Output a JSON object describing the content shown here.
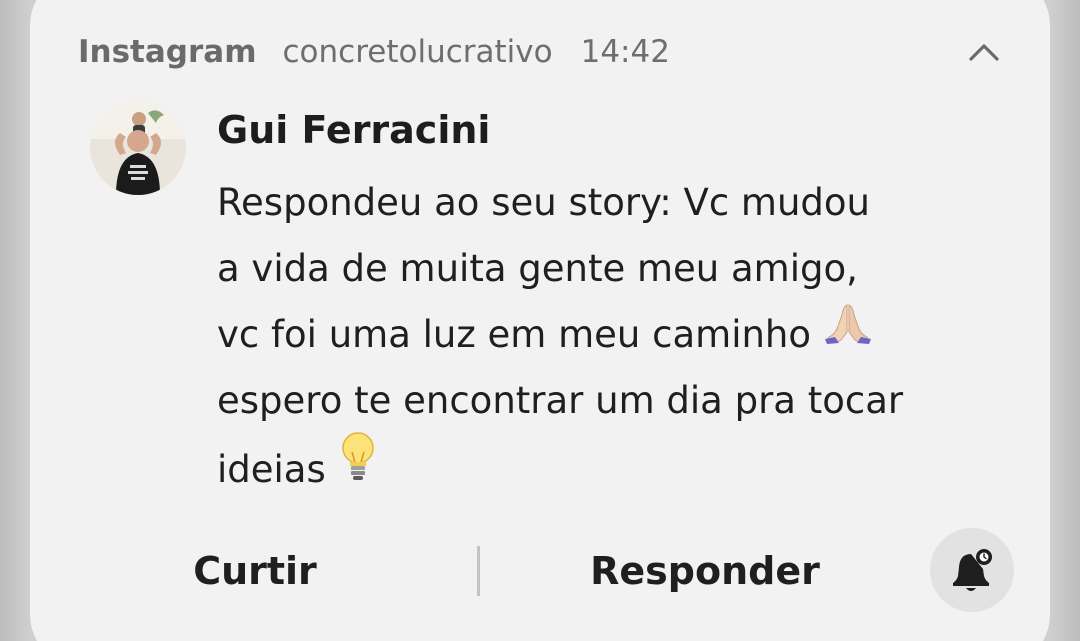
{
  "notification": {
    "app_name": "Instagram",
    "account": "concretolucrativo",
    "time": "14:42",
    "collapse_icon": "chevron-up-icon",
    "sender": "Gui Ferracini",
    "message_lines": [
      "Respondeu ao seu story: Vc mudou",
      "a vida de muita gente meu amigo,",
      "vc foi uma luz em meu caminho",
      "espero te encontrar um dia pra tocar",
      "ideias"
    ],
    "emojis": {
      "line3": "folded-hands-icon",
      "line5": "light-bulb-icon"
    }
  },
  "actions": {
    "like_label": "Curtir",
    "reply_label": "Responder",
    "mute_icon": "bell-snooze-icon"
  },
  "colors": {
    "card_background": "#f1f2f1",
    "text_primary": "#1f1f1f",
    "text_secondary": "#6e6e6e"
  }
}
